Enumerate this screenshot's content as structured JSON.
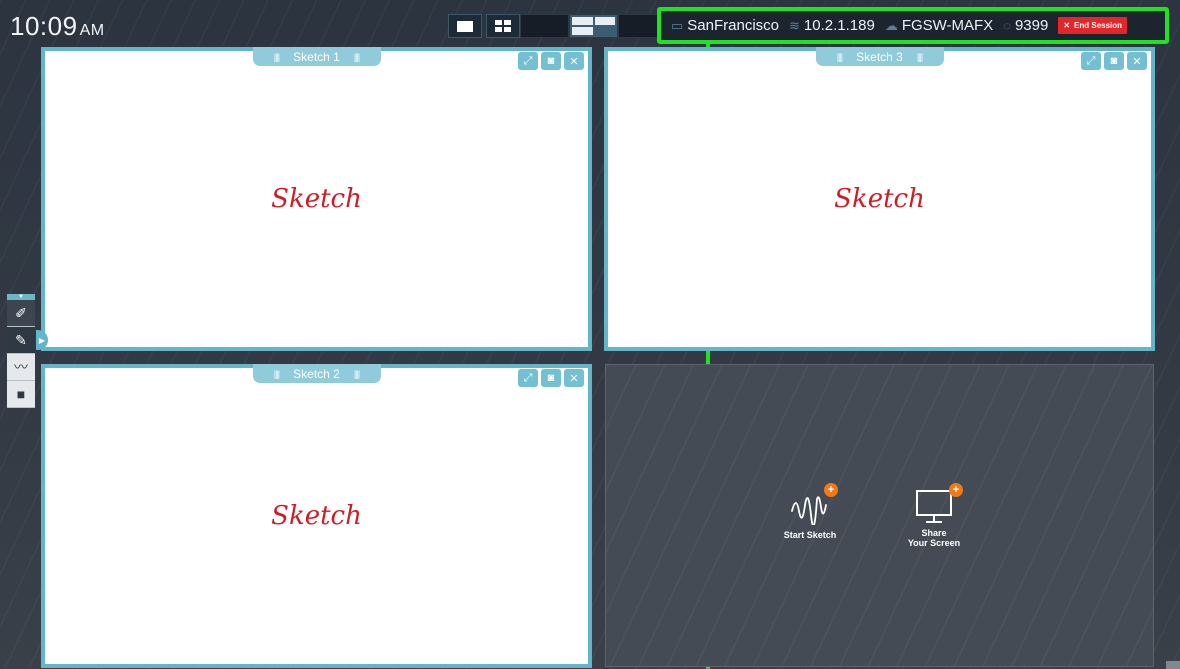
{
  "clock": {
    "time": "10:09",
    "ampm": "AM"
  },
  "layout": {
    "single_icon": "single-layout-icon",
    "quad_icon": "quad-layout-icon"
  },
  "session": {
    "room": "SanFrancisco",
    "ip": "10.2.1.189",
    "code": "FGSW-MAFX",
    "pin": "9399",
    "end_label": "End Session"
  },
  "panels": [
    {
      "title": "Sketch 1",
      "content": "Sketch"
    },
    {
      "title": "Sketch 2",
      "content": "Sketch"
    },
    {
      "title": "Sketch 3",
      "content": "Sketch"
    }
  ],
  "empty": {
    "start_sketch": "Start Sketch",
    "share_line1": "Share",
    "share_line2": "Your Screen",
    "plus": "+"
  },
  "colors": {
    "accent": "#63b5c9",
    "highlight": "#22e022",
    "end_session": "#e3262a",
    "sketch_text": "#cc1e28",
    "plus_badge": "#f07a1a"
  }
}
